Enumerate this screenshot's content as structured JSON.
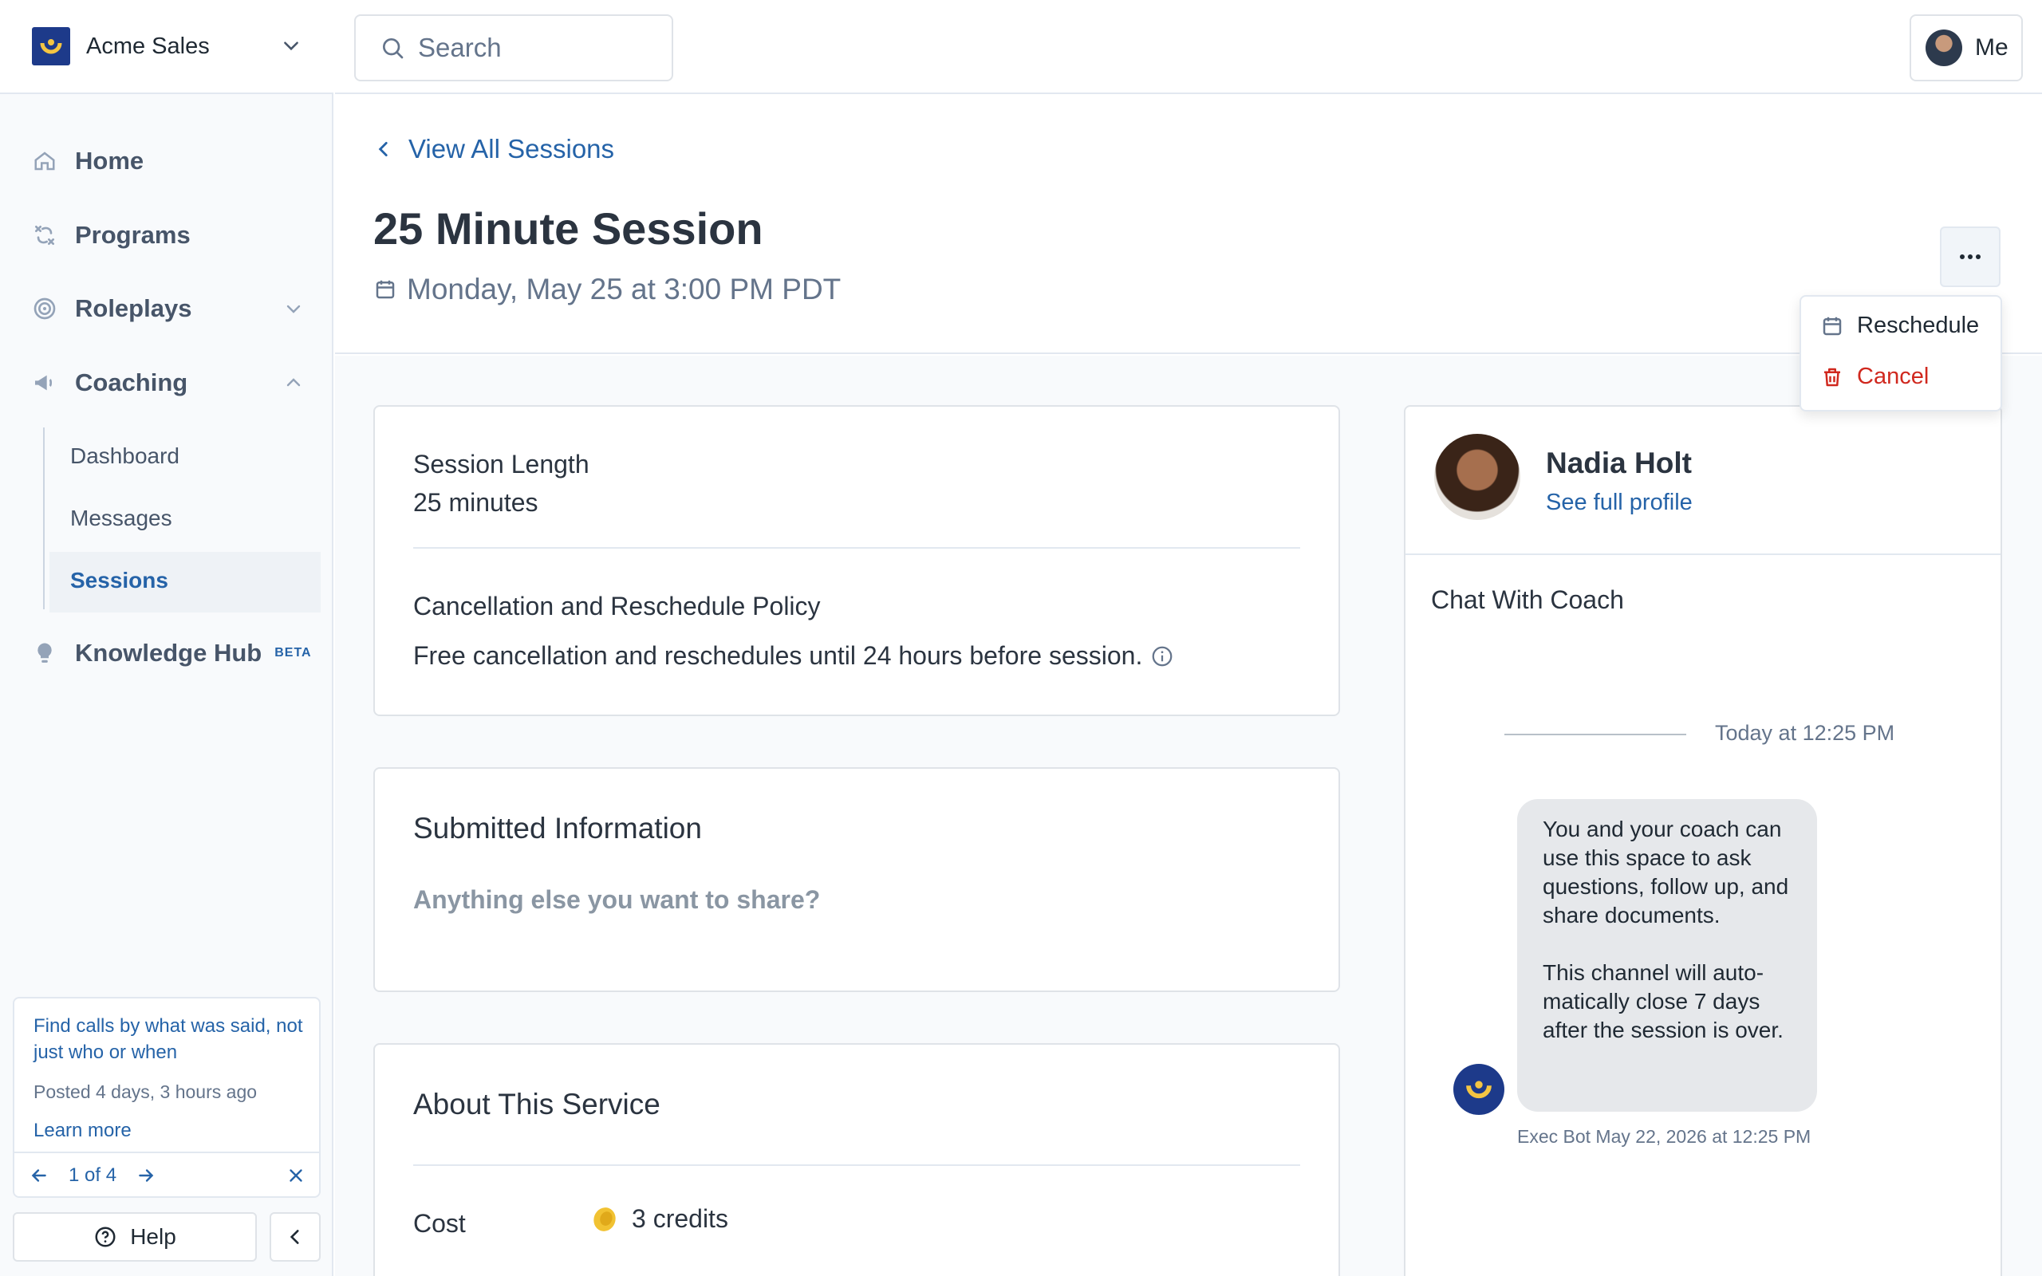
{
  "brand": {
    "name": "Acme Sales",
    "accent": "#1d3a8a"
  },
  "search": {
    "placeholder": "Search"
  },
  "user": {
    "label": "Me"
  },
  "nav": {
    "home": "Home",
    "programs": "Programs",
    "roleplays": "Roleplays",
    "coaching": "Coaching",
    "coaching_sub": [
      "Dashboard",
      "Messages",
      "Sessions"
    ],
    "knowledge_hub": "Knowledge Hub",
    "beta_badge": "BETA"
  },
  "tip": {
    "title": "Find calls by what was said, not just who or when",
    "posted": "Posted 4 days, 3 hours ago",
    "learn_more": "Learn more",
    "counter": "1 of 4"
  },
  "help": {
    "label": "Help"
  },
  "page": {
    "back_label": "View All Sessions",
    "title": "25 Minute Session",
    "datetime": "Monday, May 25 at 3:00 PM PDT"
  },
  "menu": {
    "reschedule": "Reschedule",
    "cancel": "Cancel",
    "danger_color": "#d0281e"
  },
  "session": {
    "length_label": "Session Length",
    "length_value": "25 minutes",
    "policy_label": "Cancellation and Reschedule Policy",
    "policy_value": "Free cancellation and reschedules until 24 hours before session."
  },
  "submitted": {
    "heading": "Submitted Information",
    "question": "Anything else you want to share?"
  },
  "service": {
    "heading": "About This Service",
    "cost_label": "Cost",
    "cost_value": "3 credits"
  },
  "coach": {
    "name": "Nadia Holt",
    "profile_link": "See full profile",
    "chat_heading": "Chat With Coach",
    "chat_time": "Today at 12:25 PM",
    "message_p1": "You and your coach can use this space to ask questions, follow up, and share documents.",
    "message_p2": "This channel will auto-matically close 7 days after the session is over.",
    "message_meta": "Exec Bot May 22, 2026 at 12:25 PM"
  }
}
